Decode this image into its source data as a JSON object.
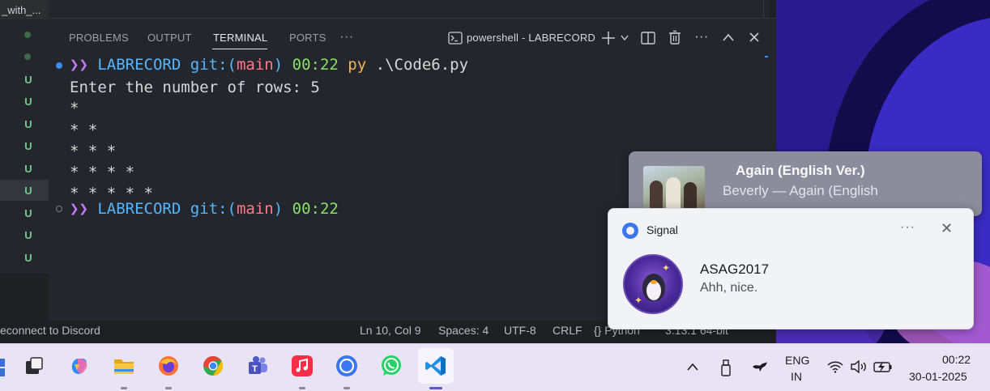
{
  "explorer": {
    "tab_title": "_with_...",
    "markers": [
      "●",
      "●",
      "U",
      "U",
      "U",
      "U",
      "U",
      "U",
      "U",
      "U",
      "U"
    ]
  },
  "panel": {
    "tabs": [
      "PROBLEMS",
      "OUTPUT",
      "TERMINAL",
      "PORTS"
    ],
    "active_tab": "TERMINAL",
    "more_label": "···",
    "terminal_name": "powershell - LABRECORD"
  },
  "terminal": {
    "prompt_arrow": "❯❯",
    "host": "LABRECORD",
    "git_prefix": "git:(",
    "branch": "main",
    "git_suffix": ")",
    "time": "00:22",
    "command_exe": "py",
    "command_arg": ".\\Code6.py",
    "output_lines": [
      "Enter the number of rows: 5",
      "*",
      "* *",
      "* * *",
      "* * * *",
      "* * * * *"
    ]
  },
  "status_bar": {
    "discord": "econnect to Discord",
    "position": "Ln 10, Col 9",
    "spaces": "Spaces: 4",
    "encoding": "UTF-8",
    "eol": "CRLF",
    "language_mode": "{} Python",
    "interpreter": "3.13.1 64-bit"
  },
  "media": {
    "title": "Again (English Ver.)",
    "subtitle": "Beverly — Again (English"
  },
  "signal": {
    "app_name": "Signal",
    "sender": "ASAG2017",
    "message": "Ahh, nice.",
    "more": "···",
    "close": "✕"
  },
  "taskbar": {
    "apps": [
      "task-view",
      "copilot",
      "file-explorer",
      "firefox",
      "chrome",
      "teams",
      "apple-music",
      "signal",
      "whatsapp",
      "vscode"
    ],
    "language_line1": "ENG",
    "language_line2": "IN",
    "time": "00:22",
    "date": "30-01-2025"
  },
  "colors": {
    "terminal_bg": "#23262c",
    "taskbar_bg": "#e8e4f5",
    "accent": "#5b58c8"
  }
}
